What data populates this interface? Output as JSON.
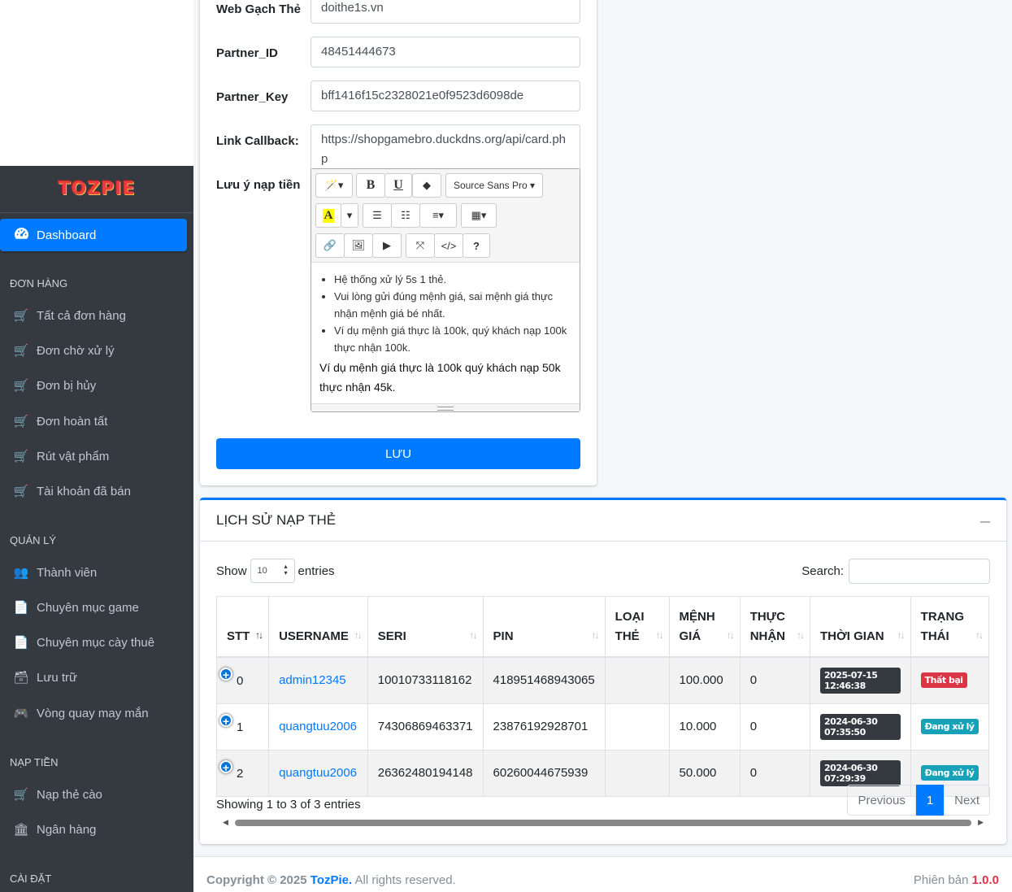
{
  "sidebar": {
    "brand": "TOZPIE",
    "active": {
      "label": "Dashboard",
      "icon": "dashboard-icon"
    },
    "sections": [
      {
        "header": "ĐƠN HÀNG"
      },
      {
        "header": "QUẢN LÝ"
      },
      {
        "header": "NẠP TIỀN"
      },
      {
        "header": "CÀI ĐẶT"
      }
    ],
    "items": [
      {
        "label": "Tất cả đơn hàng",
        "icon": "cart-icon"
      },
      {
        "label": "Đơn chờ xử lý",
        "icon": "cart-icon"
      },
      {
        "label": "Đơn bị hủy",
        "icon": "cart-icon"
      },
      {
        "label": "Đơn hoàn tất",
        "icon": "cart-icon"
      },
      {
        "label": "Rút vật phẩm",
        "icon": "cart-icon"
      },
      {
        "label": "Tài khoản đã bán",
        "icon": "cart-icon"
      },
      {
        "label": "Thành viên",
        "icon": "users-icon"
      },
      {
        "label": "Chuyên mục game",
        "icon": "file-icon"
      },
      {
        "label": "Chuyên mục cày thuê",
        "icon": "file-icon"
      },
      {
        "label": "Lưu trữ",
        "icon": "box-icon"
      },
      {
        "label": "Vòng quay may mắn",
        "icon": "gamepad-icon"
      },
      {
        "label": "Nạp thẻ cào",
        "icon": "cart-icon"
      },
      {
        "label": "Ngân hàng",
        "icon": "bank-icon"
      }
    ]
  },
  "form": {
    "fields": [
      {
        "label": "Web Gạch Thẻ",
        "value": "doithe1s.vn"
      },
      {
        "label": "Partner_ID",
        "value": "48451444673"
      },
      {
        "label": "Partner_Key",
        "value": "bff1416f15c2328021e0f9523d6098de"
      },
      {
        "label": "Link Callback:",
        "value": "https://shopgamebro.duckdns.org/api/card.php"
      }
    ],
    "note_label": "Lưu ý nạp tiền",
    "font_select": "Source Sans Pro",
    "note_bullets": [
      "Hệ thống xử lý 5s 1 thẻ.",
      "Vui lòng gửi đúng mệnh giá, sai mệnh giá thực nhận mệnh giá bé nhất.",
      "Ví dụ mệnh giá thực là 100k, quý khách nạp 100k thực nhận 100k."
    ],
    "note_paragraph": "Ví dụ mệnh giá thực là 100k quý khách nạp 50k thực nhận 45k.",
    "save_label": "LƯU"
  },
  "history": {
    "title": "LỊCH SỬ NẠP THẺ",
    "show_label": "Show",
    "entries_value": "10",
    "entries_label": "entries",
    "search_label": "Search:",
    "columns": [
      "STT",
      "USERNAME",
      "SERI",
      "PIN",
      "LOẠI THẺ",
      "MỆNH GIÁ",
      "THỰC NHẬN",
      "THỜI GIAN",
      "TRẠNG THÁI"
    ],
    "rows": [
      {
        "stt": "0",
        "username": "admin12345",
        "seri": "10010733118162",
        "pin": "418951468943065",
        "loai": "",
        "menh_gia": "100.000",
        "thuc_nhan": "0",
        "time": "2025-07-15 12:46:38",
        "status": "Thất bại",
        "status_color": "#dc3545"
      },
      {
        "stt": "1",
        "username": "quangtuu2006",
        "seri": "74306869463371",
        "pin": "23876192928701",
        "loai": "",
        "menh_gia": "10.000",
        "thuc_nhan": "0",
        "time": "2024-06-30 07:35:50",
        "status": "Đang xử lý",
        "status_color": "#17a2b8"
      },
      {
        "stt": "2",
        "username": "quangtuu2006",
        "seri": "26362480194148",
        "pin": "60260044675939",
        "loai": "",
        "menh_gia": "50.000",
        "thuc_nhan": "0",
        "time": "2024-06-30 07:29:39",
        "status": "Đang xử lý",
        "status_color": "#17a2b8"
      }
    ],
    "info": "Showing 1 to 3 of 3 entries",
    "prev": "Previous",
    "page": "1",
    "next": "Next"
  },
  "footer": {
    "copyright_prefix": "Copyright © 2025",
    "brand": "TozPie.",
    "rights": "All rights reserved.",
    "version_label": "Phiên bản",
    "version": "1.0.0"
  }
}
